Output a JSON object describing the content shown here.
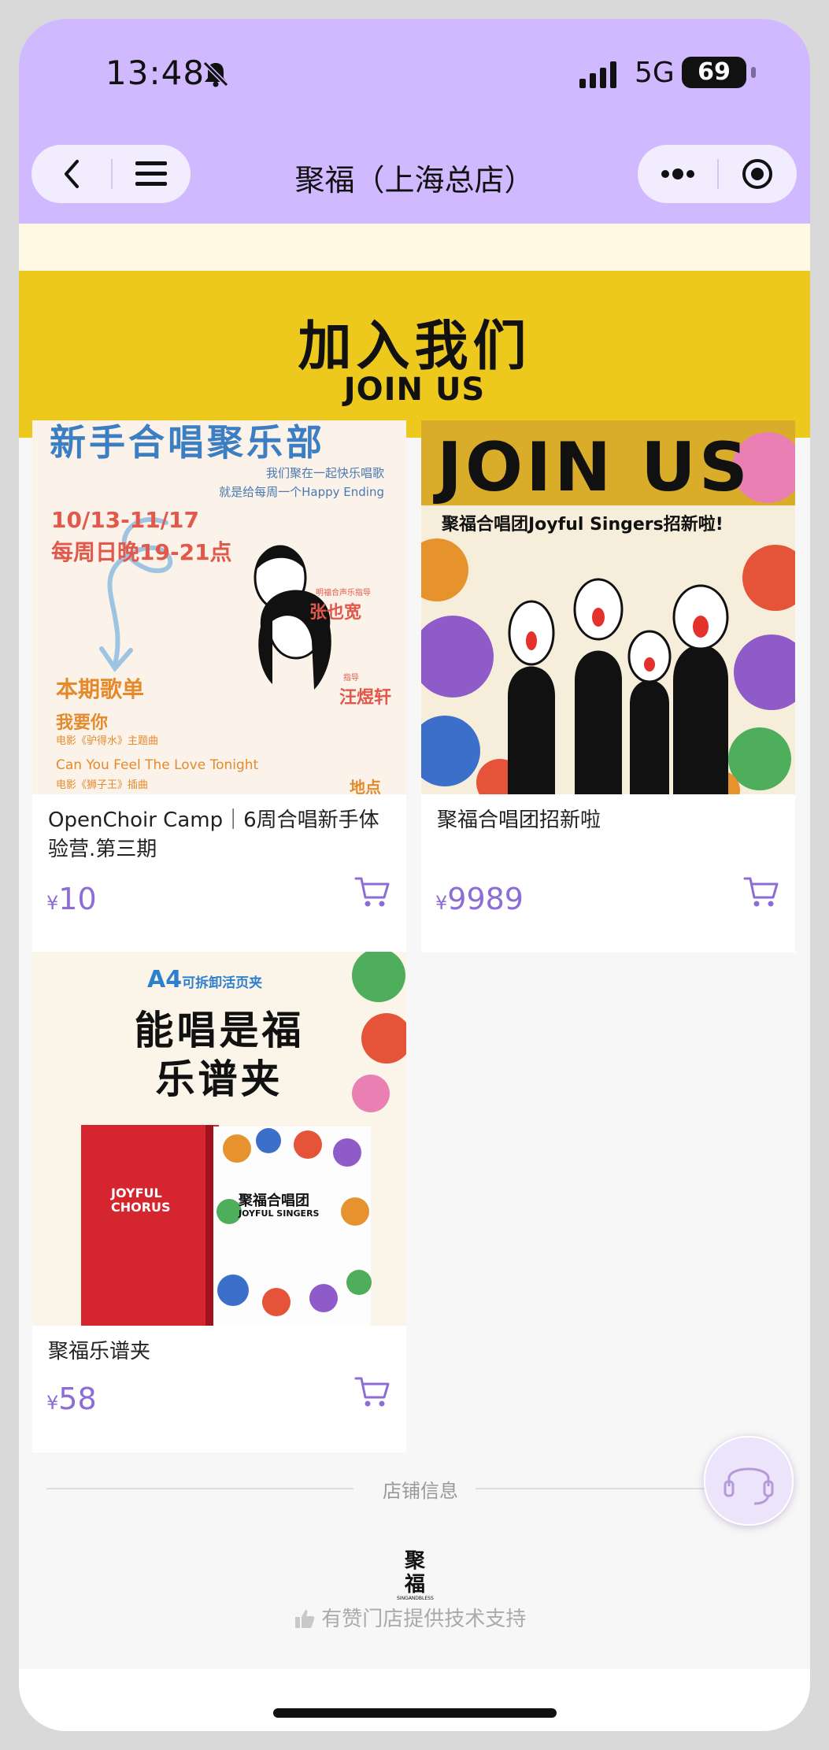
{
  "status_bar": {
    "time": "13:48",
    "network": "5G",
    "battery": "69"
  },
  "nav": {
    "title": "聚福（上海总店）"
  },
  "banner": {
    "title_zh": "加入我们",
    "title_en": "JOIN US"
  },
  "products": [
    {
      "name": "OpenChoir Camp｜6周合唱新手体验营.第三期",
      "currency": "¥",
      "price": "10",
      "image_text": {
        "heading": "新手合唱聚乐部",
        "slogan_1": "我们聚在一起快乐唱歌",
        "slogan_2": "就是给每周一个Happy Ending",
        "dates": "10/13-11/17",
        "time": "每周日晚19-21点",
        "person_1_role": "明福合声乐指导",
        "person_1": "张也宽",
        "person_2_role": "指导",
        "person_2": "汪煜轩",
        "playlist_title": "本期歌单",
        "song_1": "我要你",
        "song_1_note": "电影《驴得水》主题曲",
        "song_2": "Can You Feel The Love Tonight",
        "song_2_note": "电影《狮子王》插曲",
        "location": "地点"
      }
    },
    {
      "name": "聚福合唱团招新啦",
      "currency": "¥",
      "price": "9989",
      "image_text": {
        "heading": "JOIN US",
        "subheading": "聚福合唱团Joyful Singers招新啦!"
      }
    },
    {
      "name": "聚福乐谱夹",
      "currency": "¥",
      "price": "58",
      "image_text": {
        "tag": "A4",
        "tag_suffix": "可拆卸活页夹",
        "line_1": "能唱是福",
        "line_2": "乐谱夹",
        "folder_left": "JOYFUL CHORUS",
        "folder_right_zh": "聚福合唱团",
        "folder_right_en": "JOYFUL SINGERS"
      }
    }
  ],
  "footer": {
    "section_title": "店铺信息",
    "logo_text": "聚福",
    "logo_subtext": "SINGANDBLESS",
    "tech_support": "有赞门店提供技术支持"
  },
  "colors": {
    "accent": "#8c6cd6",
    "header_bg": "#d1b9ff",
    "banner_bg": "#edc91e"
  }
}
